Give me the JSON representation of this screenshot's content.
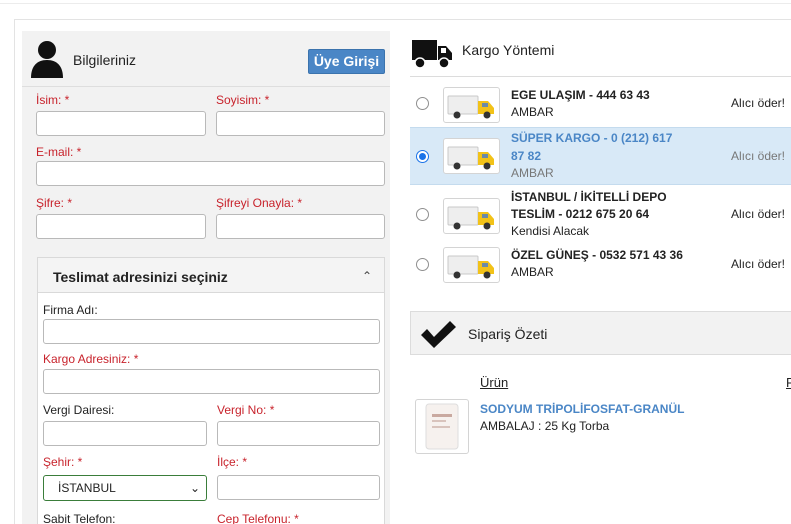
{
  "member": {
    "title": "Bilgileriniz",
    "login_button": "Üye Girişi"
  },
  "form": {
    "first_name_label": "İsim: *",
    "last_name_label": "Soyisim: *",
    "email_label": "E-mail: *",
    "password_label": "Şifre: *",
    "password_confirm_label": "Şifreyi Onayla: *",
    "first_name_value": "",
    "last_name_value": "",
    "email_value": "",
    "password_value": "",
    "password_confirm_value": ""
  },
  "address": {
    "title": "Teslimat adresinizi seçiniz",
    "company_label": "Firma Adı:",
    "cargo_address_label": "Kargo Adresiniz: *",
    "tax_office_label": "Vergi Dairesi:",
    "tax_no_label": "Vergi No: *",
    "city_label": "Şehir: *",
    "district_label": "İlçe: *",
    "city_selected": "İSTANBUL",
    "landline_label": "Sabit Telefon:",
    "mobile_label": "Cep Telefonu: *"
  },
  "shipping": {
    "title": "Kargo Yöntemi",
    "options": [
      {
        "name": "EGE ULAŞIM - 444 63 43",
        "sub": "AMBAR",
        "pay": "Alıcı öder!",
        "selected": false
      },
      {
        "name_line1": "SÜPER KARGO - 0 (212) 617",
        "name_line2": "87 82",
        "sub": "AMBAR",
        "pay": "Alıcı öder!",
        "selected": true
      },
      {
        "name_line1": "İSTANBUL / İKİTELLİ DEPO",
        "name_line2": "TESLİM - 0212 675 20 64",
        "sub": "Kendisi Alacak",
        "pay": "Alıcı öder!",
        "selected": false
      },
      {
        "name": "ÖZEL GÜNEŞ - 0532 571 43 36",
        "sub": "AMBAR",
        "pay": "Alıcı öder!",
        "selected": false
      }
    ]
  },
  "summary": {
    "title": "Sipariş Özeti",
    "column_product": "Ürün",
    "column_other": "F",
    "product_name": "SODYUM TRİPOLİFOSFAT-GRANÜL",
    "product_pack": "AMBALAJ : 25 Kg Torba"
  },
  "colors": {
    "accent": "#4a86c6",
    "required": "#c8232c",
    "selected_row": "#d8e9f7",
    "truck_yellow": "#f2c218"
  }
}
